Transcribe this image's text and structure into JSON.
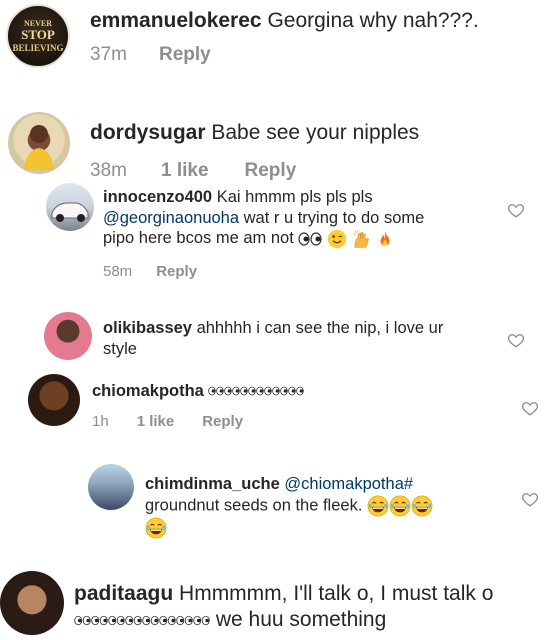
{
  "comments": [
    {
      "username": "emmanuelokerec",
      "text": "Georgina why nah???.",
      "time": "37m",
      "likes": "",
      "reply": "Reply",
      "avatar_text": "NEVER STOP BELIEVING"
    },
    {
      "username": "dordysugar",
      "text": "Babe see your nipples",
      "time": "38m",
      "likes": "1 like",
      "reply": "Reply"
    },
    {
      "username": "innocenzo400",
      "text": "Kai hmmm pls pls pls",
      "mention": "@georginaonuoha",
      "text2": "wat r u trying to do some",
      "text3": "pipo here bcos me am not",
      "time": "58m",
      "likes": "",
      "reply": "Reply"
    },
    {
      "username": "olikibassey",
      "text": "ahhhhh i can see the nip, i love ur",
      "text2": "style"
    },
    {
      "username": "chiomakpotha",
      "text": "",
      "time": "1h",
      "likes": "1 like",
      "reply": "Reply"
    },
    {
      "username": "chimdinma_uche",
      "mention": "@chiomakpotha#",
      "text2": "groundnut seeds on the fleek."
    },
    {
      "username": "paditaagu",
      "text": "Hmmmmm, I'll talk o, I must talk o",
      "text2": "we huu something"
    }
  ],
  "icons": {
    "heart": "heart-outline-icon",
    "eyes": "eyes-emoji",
    "wink": "winking-face-emoji",
    "raised_hands": "raised-hands-emoji",
    "fire": "fire-emoji",
    "laugh": "tears-of-joy-emoji"
  },
  "colors": {
    "text": "#262626",
    "meta": "#8e8e8e",
    "mention": "#00376b"
  }
}
